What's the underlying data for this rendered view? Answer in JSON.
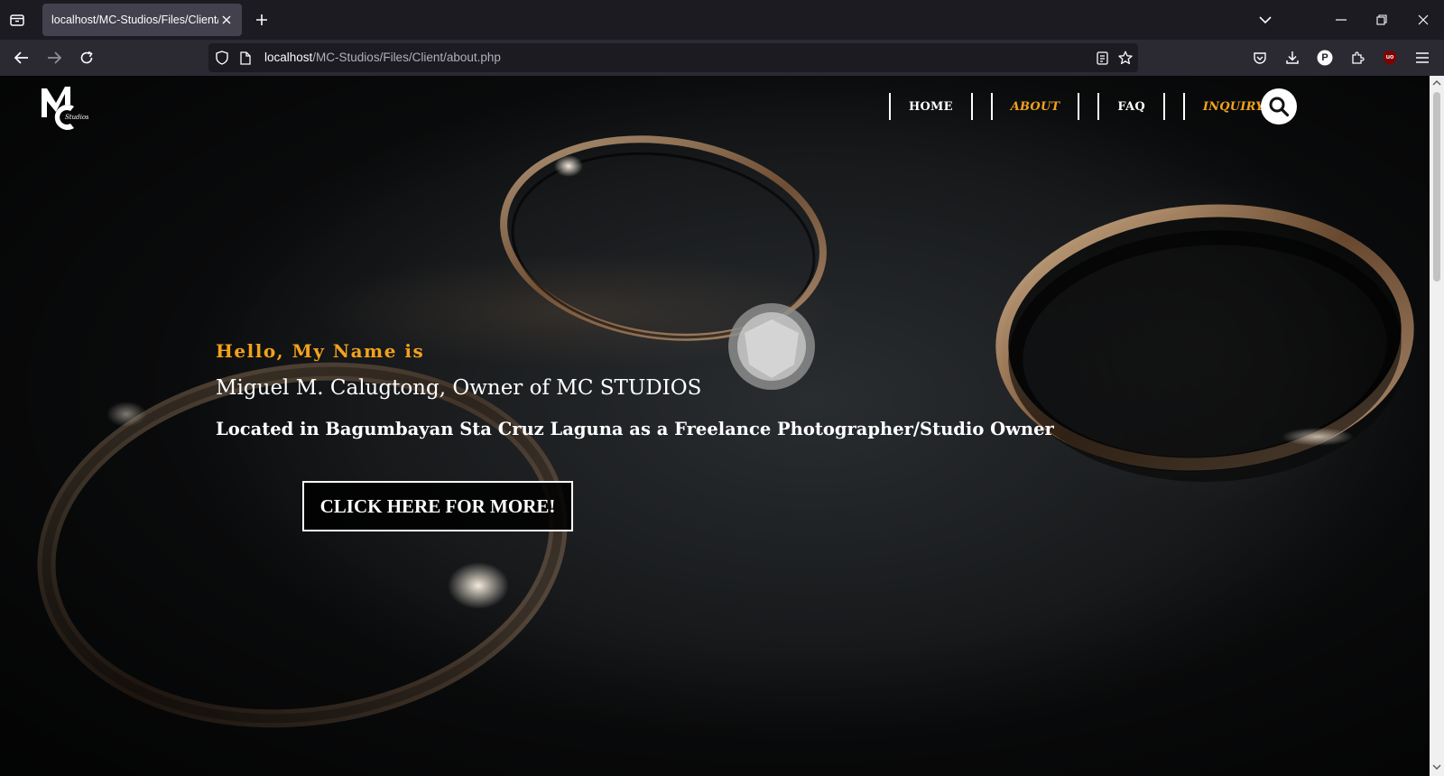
{
  "browser": {
    "tab_title": "localhost/MC-Studios/Files/Client/about.php",
    "url_host": "localhost",
    "url_path": "/MC-Studios/Files/Client/about.php",
    "profile_initial": "P",
    "extension_badge": "uo"
  },
  "site": {
    "nav": [
      {
        "label": "HOME",
        "active": false
      },
      {
        "label": "ABOUT",
        "active": true
      },
      {
        "label": "FAQ",
        "active": false
      },
      {
        "label": "INQUIRY",
        "active": true
      }
    ],
    "logo_text": "Studios"
  },
  "hero": {
    "greeting": "Hello, My Name is",
    "name": "Miguel M. Calugtong, Owner of MC STUDIOS",
    "location": "Located in Bagumbayan Sta Cruz Laguna as a Freelance Photographer/Studio Owner",
    "cta": "CLICK HERE FOR MORE!"
  },
  "colors": {
    "accent": "#f2a21c",
    "chrome_dark": "#1c1b22",
    "chrome_toolbar": "#2b2a33",
    "tab_active": "#42414d"
  }
}
